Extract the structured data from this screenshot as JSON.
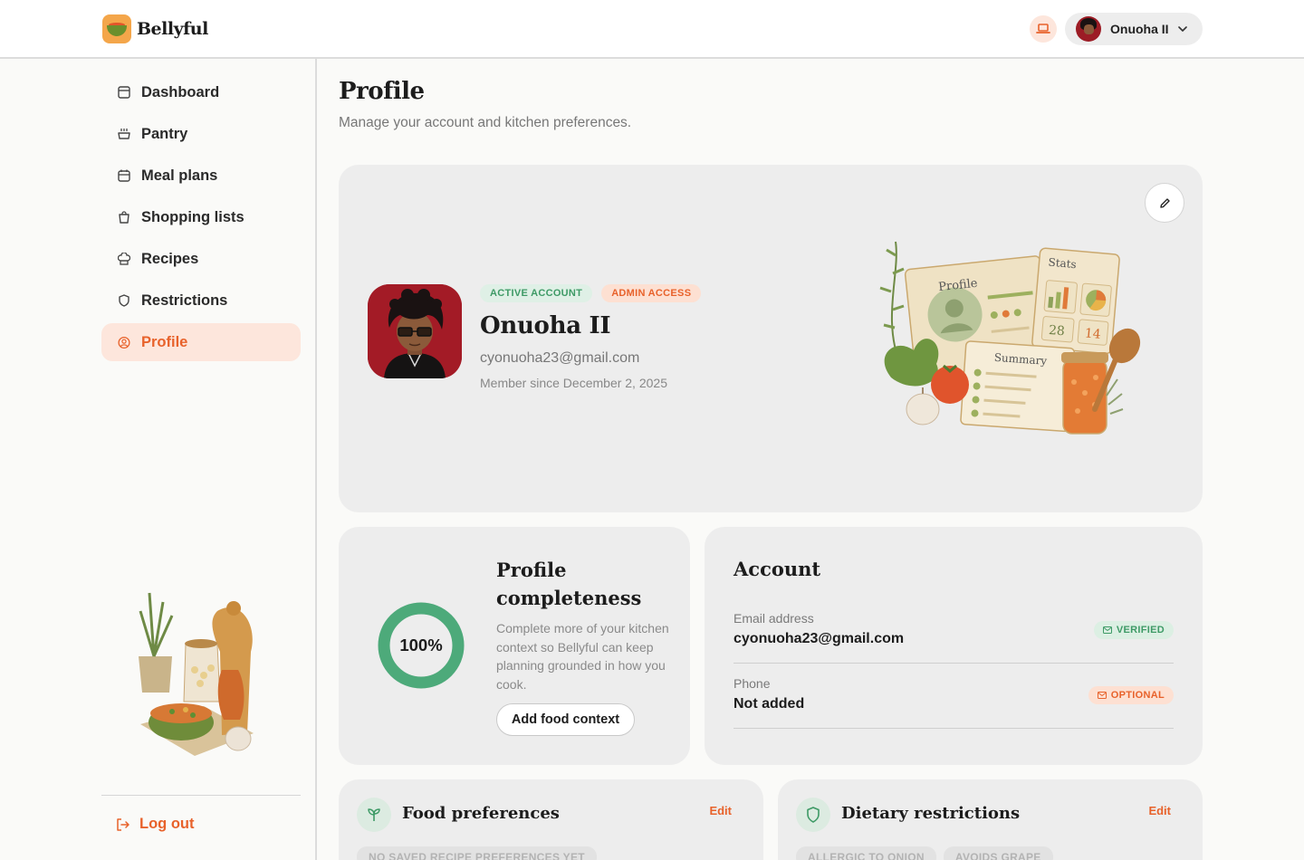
{
  "app": {
    "name": "Bellyful"
  },
  "header": {
    "user_name": "Onuoha II"
  },
  "sidebar": {
    "items": [
      {
        "label": "Dashboard"
      },
      {
        "label": "Pantry"
      },
      {
        "label": "Meal plans"
      },
      {
        "label": "Shopping lists"
      },
      {
        "label": "Recipes"
      },
      {
        "label": "Restrictions"
      },
      {
        "label": "Profile"
      }
    ],
    "logout_label": "Log out"
  },
  "page": {
    "title": "Profile",
    "subtitle": "Manage your account and kitchen preferences."
  },
  "hero": {
    "badges": [
      "ACTIVE ACCOUNT",
      "ADMIN ACCESS"
    ],
    "name": "Onuoha II",
    "email": "cyonuoha23@gmail.com",
    "member_since": "Member since December 2, 2025",
    "illustration_labels": {
      "profile": "Profile",
      "stats": "Stats",
      "summary": "Summary",
      "stat_a": "28",
      "stat_b": "14"
    }
  },
  "completeness": {
    "title": "Profile completeness",
    "percent_label": "100%",
    "percent": 100,
    "description": "Complete more of your kitchen context so Bellyful can keep planning grounded in how you cook.",
    "button_label": "Add food context"
  },
  "account": {
    "title": "Account",
    "email_label": "Email address",
    "email_value": "cyonuoha23@gmail.com",
    "email_status": "VERIFIED",
    "phone_label": "Phone",
    "phone_value": "Not added",
    "phone_status": "OPTIONAL"
  },
  "food_preferences": {
    "title": "Food preferences",
    "edit_label": "Edit",
    "tags": [
      "NO SAVED RECIPE PREFERENCES YET"
    ]
  },
  "dietary_restrictions": {
    "title": "Dietary restrictions",
    "edit_label": "Edit",
    "tags": [
      "ALLERGIC TO ONION",
      "AVOIDS GRAPE"
    ]
  },
  "colors": {
    "accent": "#e8622b",
    "accent_soft": "#fde6dc",
    "success": "#3e9a66",
    "card": "#ededed"
  }
}
